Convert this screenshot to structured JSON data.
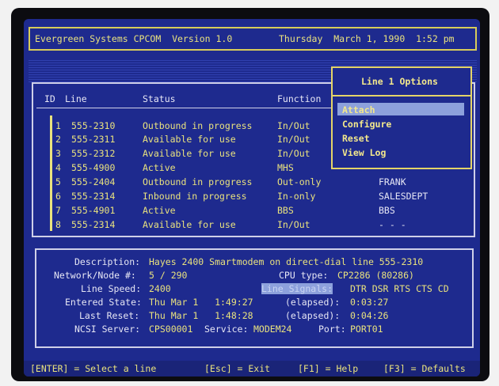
{
  "header": {
    "app_title": "Evergreen Systems CPCOM  Version 1.0",
    "date_time": "Thursday  March 1, 1990  1:52 pm"
  },
  "lines_table": {
    "columns": [
      "ID",
      "Line",
      "Status",
      "Function"
    ],
    "rows": [
      {
        "id": "1",
        "line": "555-2310",
        "status": "Outbound in progress",
        "function": "In/Out",
        "user": ""
      },
      {
        "id": "2",
        "line": "555-2311",
        "status": "Available for use",
        "function": "In/Out",
        "user": ""
      },
      {
        "id": "3",
        "line": "555-2312",
        "status": "Available for use",
        "function": "In/Out",
        "user": ""
      },
      {
        "id": "4",
        "line": "555-4900",
        "status": "Active",
        "function": "MHS",
        "user": ""
      },
      {
        "id": "5",
        "line": "555-2404",
        "status": "Outbound in progress",
        "function": "Out-only",
        "user": "FRANK"
      },
      {
        "id": "6",
        "line": "555-2314",
        "status": "Inbound in progress",
        "function": "In-only",
        "user": "SALESDEPT"
      },
      {
        "id": "7",
        "line": "555-4901",
        "status": "Active",
        "function": "BBS",
        "user": "BBS"
      },
      {
        "id": "8",
        "line": "555-2314",
        "status": "Available for use",
        "function": "In/Out",
        "user": "- - -"
      }
    ]
  },
  "options_menu": {
    "title": "Line 1 Options",
    "items": [
      "Attach",
      "Configure",
      "Reset",
      "View Log"
    ],
    "selected_index": 0
  },
  "details": {
    "description_label": "Description:",
    "description_value": "Hayes 2400 Smartmodem on direct-dial line 555-2310",
    "network_label": "Network/Node #:",
    "network_value": "5 / 290",
    "cpu_label": "CPU type:",
    "cpu_value": "CP2286 (80286)",
    "speed_label": "Line Speed:",
    "speed_value": "2400",
    "signals_label": "Line Signals:",
    "signals_value": "DTR DSR RTS CTS CD",
    "entered_label": "Entered State:",
    "entered_value": "Thu Mar 1   1:49:27",
    "elapsed_label_1": "(elapsed):",
    "elapsed_value_1": "0:03:27",
    "reset_label": "Last Reset:",
    "reset_value": "Thu Mar 1   1:48:28",
    "elapsed_label_2": "(elapsed):",
    "elapsed_value_2": "0:04:26",
    "server_label": "NCSI Server:",
    "server_value": "CPS00001",
    "service_label": "Service:",
    "service_value": "MODEM24",
    "port_label": "Port:",
    "port_value": "PORT01"
  },
  "footer": {
    "enter_hint": "[ENTER] = Select a line",
    "esc_hint": "[Esc] = Exit",
    "f1_hint": "[F1] = Help",
    "f3_hint": "[F3] = Defaults"
  }
}
